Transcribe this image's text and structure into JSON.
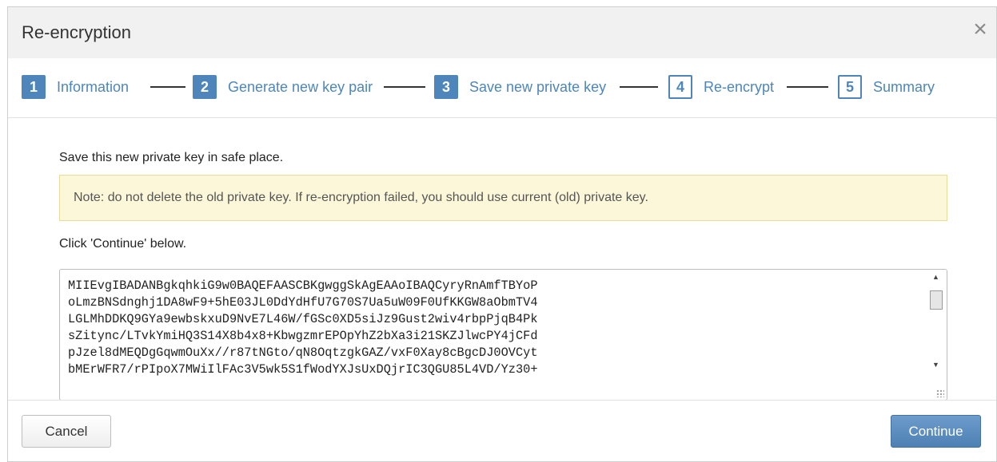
{
  "dialog": {
    "title": "Re-encryption",
    "close_icon": "close-icon"
  },
  "wizard": {
    "steps": [
      {
        "number": "1",
        "label": "Information",
        "state": "done"
      },
      {
        "number": "2",
        "label": "Generate new key pair",
        "state": "done"
      },
      {
        "number": "3",
        "label": "Save new private key",
        "state": "current"
      },
      {
        "number": "4",
        "label": "Re-encrypt",
        "state": "todo"
      },
      {
        "number": "5",
        "label": "Summary",
        "state": "todo"
      }
    ]
  },
  "content": {
    "intro": "Save this new private key in safe place.",
    "note": "Note: do not delete the old private key. If re-encryption failed, you should use current (old) private key.",
    "instruction": "Click 'Continue' below.",
    "private_key": "MIIEvgIBADANBgkqhkiG9w0BAQEFAASCBKgwggSkAgEAAoIBAQCyryRnAmfTBYoP\noLmzBNSdnghj1DA8wF9+5hE03JL0DdYdHfU7G70S7Ua5uW09F0UfKKGW8aObmTV4\nLGLMhDDKQ9GYa9ewbskxuD9NvE7L46W/fGSc0XD5siJz9Gust2wiv4rbpPjqB4Pk\nsZitync/LTvkYmiHQ3S14X8b4x8+KbwgzmrEPOpYhZ2bXa3i21SKZJlwcPY4jCFd\npJzel8dMEQDgGqwmOuXx//r87tNGto/qN8OqtzgkGAZ/vxF0Xay8cBgcDJ0OVCyt\nbMErWFR7/rPIpoX7MWiIlFAc3V5wk5S1fWodYXJsUxDQjrIC3QGU85L4VD/Yz30+"
  },
  "footer": {
    "cancel_label": "Cancel",
    "continue_label": "Continue"
  },
  "colors": {
    "accent": "#4e86bb",
    "note_bg": "#fcf7d8",
    "continue_bg": "#5a8bbf"
  }
}
